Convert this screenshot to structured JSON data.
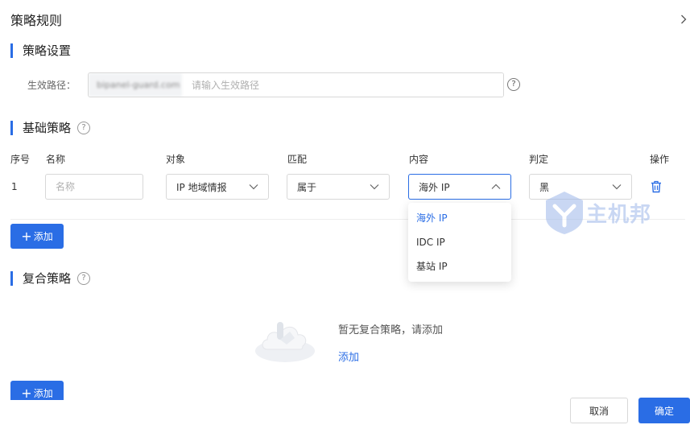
{
  "panel": {
    "title": "策略规则"
  },
  "strategy_settings": {
    "heading": "策略设置",
    "path_label": "生效路径：",
    "path_prefix": "bipanel-guard.com",
    "path_placeholder": "请输入生效路径",
    "help_glyph": "?"
  },
  "basic_strategy": {
    "heading": "基础策略",
    "help_glyph": "?",
    "columns": [
      "序号",
      "名称",
      "对象",
      "匹配",
      "内容",
      "判定",
      "操作"
    ],
    "row": {
      "index": "1",
      "name_placeholder": "名称",
      "object": "IP 地域情报",
      "match": "属于",
      "content": "海外 IP",
      "verdict": "黑"
    },
    "add_label": "添加",
    "add_plus": "+"
  },
  "content_dropdown": {
    "options": [
      "海外 IP",
      "IDC IP",
      "基站 IP"
    ],
    "selected_index": 0
  },
  "composite_strategy": {
    "heading": "复合策略",
    "help_glyph": "?",
    "empty_text": "暂无复合策略，请添加",
    "empty_link": "添加",
    "add_label": "添加",
    "add_plus": "+"
  },
  "watermark": {
    "text": "主机邦"
  },
  "footer": {
    "cancel_label": "取消",
    "confirm_label": "确定"
  },
  "colors": {
    "accent": "#2a6de5",
    "border": "#d8d8d8",
    "muted": "#b0b0b0"
  },
  "icons": [
    "chevron-right-icon",
    "help-icon",
    "chevron-down-icon",
    "chevron-up-icon",
    "trash-icon",
    "plus-icon",
    "empty-cloud-icon",
    "watermark-logo-icon"
  ]
}
